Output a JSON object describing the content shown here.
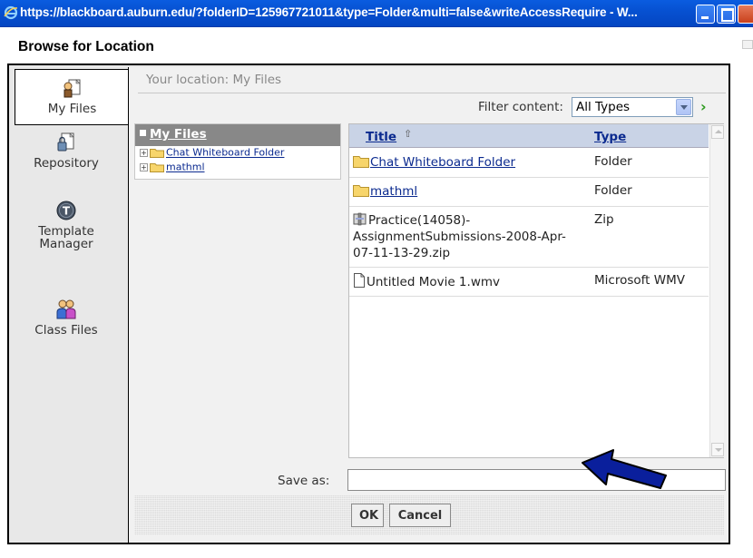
{
  "window": {
    "title": "https://blackboard.auburn.edu/?folderID=125967721011&type=Folder&multi=false&writeAccessRequire - W..."
  },
  "dialog": {
    "heading": "Browse for Location",
    "location": "Your location: My Files"
  },
  "sidebar": {
    "items": [
      {
        "label": "My Files",
        "icon": "my-files-icon",
        "selected": true
      },
      {
        "label": "Repository",
        "icon": "repository-icon"
      },
      {
        "label": "Template Manager",
        "label_lines": [
          "Template",
          "Manager"
        ],
        "icon": "template-manager-icon"
      },
      {
        "label": "Class Files",
        "icon": "class-files-icon"
      }
    ]
  },
  "filter": {
    "label": "Filter content:",
    "selected": "All Types"
  },
  "tree": {
    "root": "My Files",
    "items": [
      {
        "label": "Chat Whiteboard Folder"
      },
      {
        "label": "mathml"
      }
    ]
  },
  "filelist": {
    "columns": {
      "title": "Title",
      "type": "Type"
    },
    "rows": [
      {
        "name": "Chat Whiteboard Folder",
        "type": "Folder",
        "icon": "folder-icon",
        "link": true
      },
      {
        "name": "mathml",
        "type": "Folder",
        "icon": "folder-icon",
        "link": true
      },
      {
        "name": "Practice(14058)-AssignmentSubmissions-2008-Apr-07-11-13-29.zip",
        "name_lines": [
          "Practice(14058)-",
          "AssignmentSubmissions-2008-Apr-",
          "07-11-13-29.zip"
        ],
        "type": "Zip",
        "icon": "zip-icon",
        "link": false
      },
      {
        "name": "Untitled Movie 1.wmv",
        "type": "Microsoft WMV",
        "icon": "document-icon",
        "link": false
      }
    ]
  },
  "saveas": {
    "label": "Save as:",
    "value": ""
  },
  "buttons": {
    "ok": "OK",
    "cancel": "Cancel"
  },
  "colors": {
    "titlebar": "#0650d0",
    "link": "#0b2a8f",
    "header_bg": "#c9d3e6",
    "arrow": "#0a1f9c",
    "go_arrow": "#2e9a1e"
  }
}
